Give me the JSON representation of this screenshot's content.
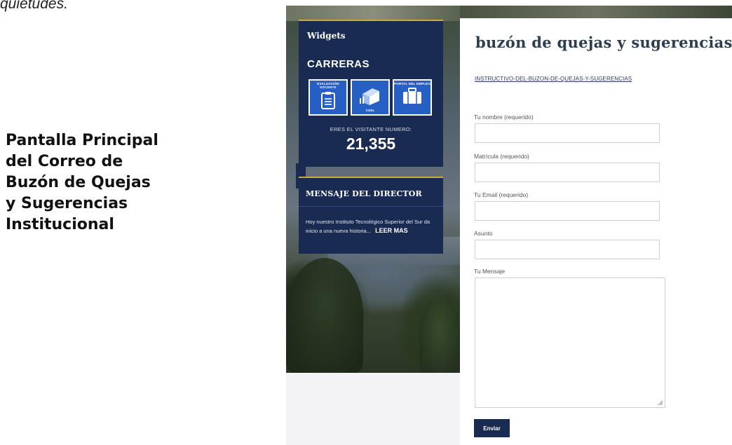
{
  "top_text": "quietudes.",
  "caption": [
    "Pantalla Principal",
    "del Correo de",
    "Buzón de Quejas",
    "y Sugerencias",
    "Institucional"
  ],
  "widgets": {
    "title": "Widgets",
    "carreras": "CARRERAS",
    "tiles": [
      {
        "label_top": "EVALUACIÓN DOCENTE",
        "icon": "clipboard-icon",
        "label_bottom": ""
      },
      {
        "label_top": "",
        "icon": "building-icon",
        "label_bottom": "CGEL"
      },
      {
        "label_top": "PORTAL DEL EMPLEO",
        "icon": "briefcase-icon",
        "label_bottom": ""
      }
    ],
    "visitor_label": "ERES EL VISITANTE NUMERO:",
    "visitor_count": "21,355"
  },
  "director": {
    "title": "MENSAJE DEL DIRECTOR",
    "text": "Hoy nuestro Instituto Tecnológico Superior del Sur da inicio a una nueva historia...",
    "read_more": "LEER MAS"
  },
  "form": {
    "heading": "buzón de quejas y sugerencias",
    "instructive_link": "INSTRUCTIVO-DEL-BUZON-DE-QUEJAS-Y-SUGERENCIAS",
    "fields": {
      "name_label": "Tu nombre (requerido)",
      "matricula_label": "Matrícula (requerido)",
      "email_label": "Tu Email (requerido)",
      "subject_label": "Asunto",
      "message_label": "Tu Mensaje"
    },
    "submit_label": "Enviar"
  },
  "colors": {
    "widget_bg": "#1a2b52",
    "accent_gold": "#d0a83a",
    "tile_blue": "#2660c4",
    "heading": "#2c3e50"
  }
}
